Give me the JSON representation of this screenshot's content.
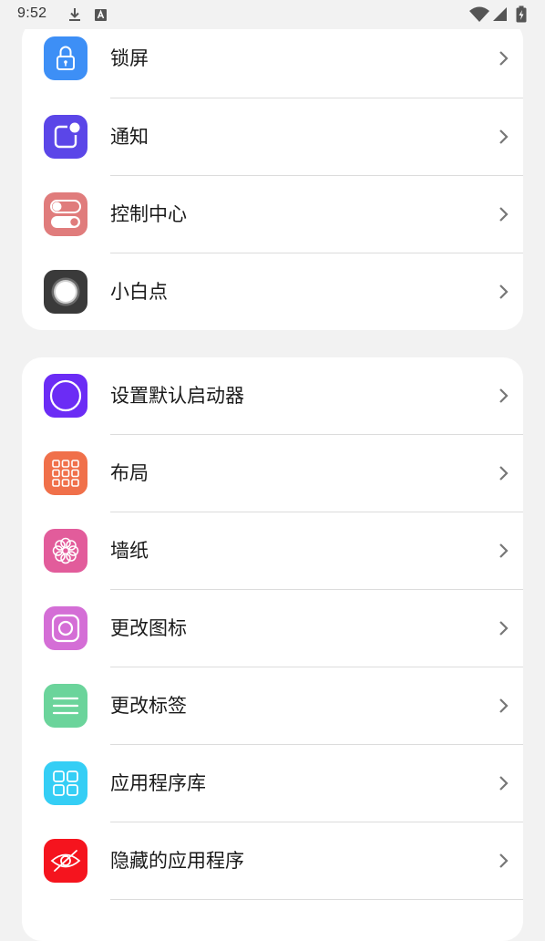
{
  "status_bar": {
    "time": "9:52",
    "icons": [
      "download-icon",
      "a-icon",
      "wifi-icon",
      "signal-icon",
      "battery-icon"
    ]
  },
  "groups": [
    {
      "items": [
        {
          "label": "锁屏",
          "icon": "lock-icon",
          "color": "#3D8FF6"
        },
        {
          "label": "通知",
          "icon": "notification-icon",
          "color": "#5B46E8"
        },
        {
          "label": "控制中心",
          "icon": "toggle-icon",
          "color": "#E07C7C"
        },
        {
          "label": "小白点",
          "icon": "assistive-touch-icon",
          "color": "#3A3A3A"
        }
      ]
    },
    {
      "items": [
        {
          "label": "设置默认启动器",
          "icon": "circle-icon",
          "color": "#6B2CF5"
        },
        {
          "label": "布局",
          "icon": "grid-icon",
          "color": "#F0704A"
        },
        {
          "label": "墙纸",
          "icon": "flower-icon",
          "color": "#E25C9B"
        },
        {
          "label": "更改图标",
          "icon": "instagram-icon",
          "color": "#D46ED6"
        },
        {
          "label": "更改标签",
          "icon": "menu-lines-icon",
          "color": "#6BD49B"
        },
        {
          "label": "应用程序库",
          "icon": "app-library-icon",
          "color": "#35CEF5"
        },
        {
          "label": "隐藏的应用程序",
          "icon": "eye-off-icon",
          "color": "#F5141E"
        }
      ]
    }
  ]
}
